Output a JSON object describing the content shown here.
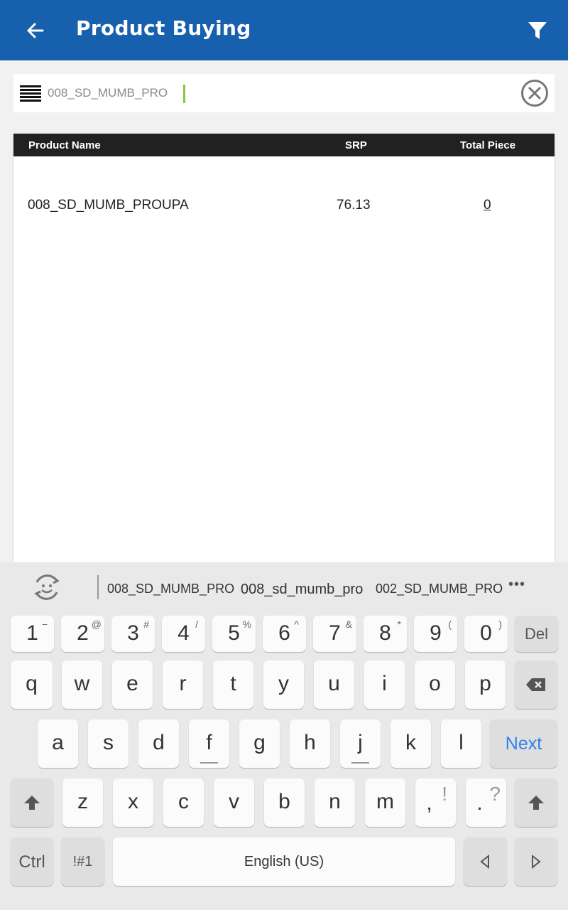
{
  "appbar": {
    "title": "Product Buying",
    "color": "#1760ad",
    "icons": [
      "back-arrow-icon",
      "filter-icon"
    ]
  },
  "search": {
    "value": "008_SD_MUMB_PRO",
    "icons": [
      "menu-icon",
      "clear-circle-icon"
    ],
    "caret_color": "#8bc34a"
  },
  "table": {
    "headers": [
      "Product Name",
      "SRP",
      "Total Piece"
    ],
    "rows": [
      {
        "name": "008_SD_MUMB_PROUPA",
        "srp": "76.13",
        "qty": "0"
      }
    ]
  },
  "keyboard": {
    "suggestions": [
      "008_SD_MUMB_PRO",
      "008_sd_mumb_pro",
      "002_SD_MUMB_PRO"
    ],
    "more": "•••",
    "row1": [
      {
        "k": "1",
        "s": "−"
      },
      {
        "k": "2",
        "s": "@"
      },
      {
        "k": "3",
        "s": "#"
      },
      {
        "k": "4",
        "s": "/"
      },
      {
        "k": "5",
        "s": "%"
      },
      {
        "k": "6",
        "s": "^"
      },
      {
        "k": "7",
        "s": "&"
      },
      {
        "k": "8",
        "s": "*"
      },
      {
        "k": "9",
        "s": "("
      },
      {
        "k": "0",
        "s": ")"
      }
    ],
    "del": "Del",
    "row2": [
      "q",
      "w",
      "e",
      "r",
      "t",
      "y",
      "u",
      "i",
      "o",
      "p"
    ],
    "row3": [
      "a",
      "s",
      "d",
      "f",
      "g",
      "h",
      "j",
      "k",
      "l"
    ],
    "next": "Next",
    "row4": [
      "z",
      "x",
      "c",
      "v",
      "b",
      "n",
      "m"
    ],
    "comma": {
      "k": ",",
      "s": "!"
    },
    "period": {
      "k": ".",
      "s": "?"
    },
    "ctrl": "Ctrl",
    "sym": "!#1",
    "space": "English (US)",
    "accent": "#2e84e8"
  }
}
